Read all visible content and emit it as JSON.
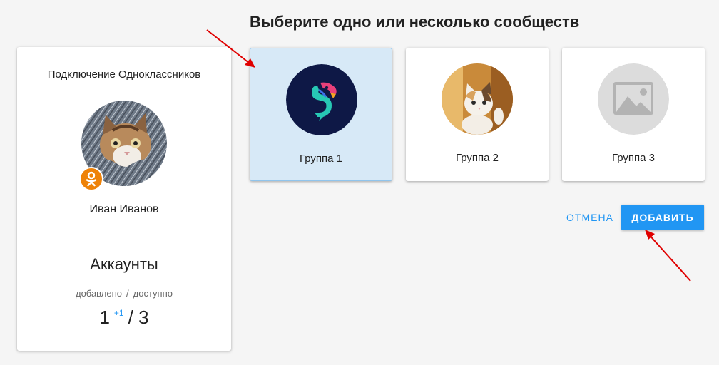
{
  "connection": {
    "title": "Подключение Одноклассников",
    "user_name": "Иван Иванов",
    "accounts_title": "Аккаунты",
    "added_label": "добавлено",
    "separator": "/",
    "available_label": "доступно",
    "added_count": "1",
    "added_delta": "+1",
    "count_separator": "/",
    "available_count": "3",
    "badge_icon": "odnoklassniki-icon",
    "badge_color": "#ee8208"
  },
  "heading": "Выберите одно или несколько сообществ",
  "groups": [
    {
      "label": "Группа 1",
      "icon": "parrot-logo-icon",
      "selected": true
    },
    {
      "label": "Группа 2",
      "icon": "kitten-photo",
      "selected": false
    },
    {
      "label": "Группа 3",
      "icon": "image-placeholder-icon",
      "selected": false
    }
  ],
  "actions": {
    "cancel_label": "ОТМЕНА",
    "add_label": "ДОБАВИТЬ"
  },
  "colors": {
    "accent": "#2196f3",
    "selected_card": "#d7e9f7",
    "annotation_arrow": "#e00000"
  }
}
